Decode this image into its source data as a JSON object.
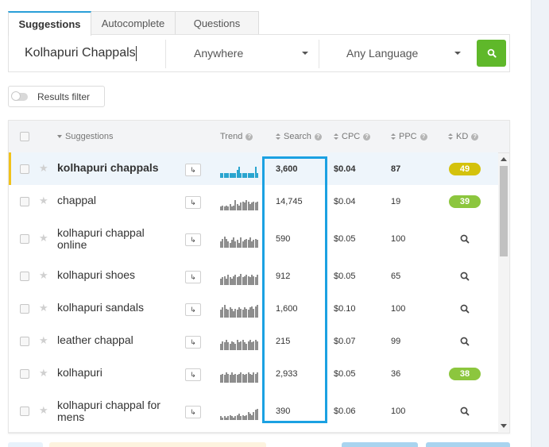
{
  "tabs": [
    {
      "label": "Suggestions",
      "active": true
    },
    {
      "label": "Autocomplete",
      "active": false
    },
    {
      "label": "Questions",
      "active": false
    }
  ],
  "search": {
    "keyword": "Kolhapuri Chappals",
    "location": "Anywhere",
    "language": "Any Language",
    "button_icon": "search-icon"
  },
  "filter": {
    "label": "Results filter",
    "enabled": false
  },
  "table": {
    "headers": {
      "suggestions": "Suggestions",
      "trend": "Trend",
      "search": "Search",
      "cpc": "CPC",
      "ppc": "PPC",
      "kd": "KD"
    },
    "rows": [
      {
        "keyword": "kolhapuri chappals",
        "search": "3,600",
        "cpc": "$0.04",
        "ppc": "87",
        "kd": "49",
        "kd_color": "#d4c20c",
        "trend": [
          0.35,
          0.35,
          0.35,
          0.35,
          0.35,
          0.35,
          0.35,
          0.35,
          0.35,
          0.6,
          0.9,
          0.35,
          0.35,
          0.35,
          0.4,
          0.35,
          0.35,
          0.35,
          0.4,
          0.9,
          0.35
        ],
        "highlighted": true
      },
      {
        "keyword": "chappal",
        "search": "14,745",
        "cpc": "$0.04",
        "ppc": "19",
        "kd": "39",
        "kd_color": "#8cc63e",
        "trend": [
          0.3,
          0.4,
          0.3,
          0.4,
          0.3,
          0.5,
          0.3,
          0.4,
          0.8,
          0.5,
          0.4,
          0.6,
          0.7,
          0.6,
          0.8,
          0.7,
          0.5,
          0.6,
          0.7,
          0.6,
          0.7
        ],
        "highlighted": false
      },
      {
        "keyword": "kolhapuri chappal online",
        "search": "590",
        "cpc": "$0.05",
        "ppc": "100",
        "kd": "",
        "trend": [
          0.5,
          0.7,
          0.9,
          0.7,
          0.5,
          0.4,
          0.6,
          0.8,
          0.5,
          0.6,
          0.4,
          0.8,
          0.5,
          0.6,
          0.7,
          0.6,
          0.8,
          0.5,
          0.6,
          0.7,
          0.6
        ],
        "highlighted": false
      },
      {
        "keyword": "kolhapuri shoes",
        "search": "912",
        "cpc": "$0.05",
        "ppc": "65",
        "kd": "",
        "trend": [
          0.5,
          0.6,
          0.7,
          0.5,
          0.8,
          0.6,
          0.5,
          0.7,
          0.8,
          0.6,
          0.7,
          0.9,
          0.6,
          0.7,
          0.8,
          0.7,
          0.6,
          0.8,
          0.7,
          0.6,
          0.8
        ],
        "highlighted": false
      },
      {
        "keyword": "kolhapuri sandals",
        "search": "1,600",
        "cpc": "$0.10",
        "ppc": "100",
        "kd": "",
        "trend": [
          0.6,
          0.8,
          1.0,
          0.7,
          0.6,
          0.8,
          0.7,
          0.5,
          0.7,
          0.6,
          0.8,
          0.7,
          0.6,
          0.8,
          0.7,
          0.6,
          0.8,
          0.9,
          0.7,
          0.9,
          1.0
        ],
        "highlighted": false
      },
      {
        "keyword": "leather chappal",
        "search": "215",
        "cpc": "$0.07",
        "ppc": "99",
        "kd": "",
        "trend": [
          0.5,
          0.7,
          0.6,
          0.8,
          0.6,
          0.5,
          0.7,
          0.6,
          0.5,
          0.8,
          0.6,
          0.7,
          0.8,
          0.6,
          0.5,
          0.7,
          0.8,
          0.6,
          0.7,
          0.8,
          0.7
        ],
        "highlighted": false
      },
      {
        "keyword": "kolhapuri",
        "search": "2,933",
        "cpc": "$0.05",
        "ppc": "36",
        "kd": "38",
        "kd_color": "#8cc63e",
        "trend": [
          0.6,
          0.7,
          0.6,
          0.8,
          0.7,
          0.6,
          0.8,
          0.6,
          0.7,
          0.6,
          0.7,
          0.8,
          0.7,
          0.6,
          0.7,
          0.8,
          0.7,
          0.6,
          0.8,
          0.7,
          0.8
        ],
        "highlighted": false
      },
      {
        "keyword": "kolhapuri chappal for mens",
        "search": "390",
        "cpc": "$0.06",
        "ppc": "100",
        "kd": "",
        "trend": [
          0.3,
          0.2,
          0.3,
          0.2,
          0.3,
          0.4,
          0.3,
          0.2,
          0.3,
          0.4,
          0.5,
          0.3,
          0.4,
          0.3,
          0.4,
          0.6,
          0.5,
          0.4,
          0.6,
          0.8,
          0.9
        ],
        "highlighted": false
      }
    ]
  },
  "colors": {
    "accent_tab": "#2a9fd8",
    "search_button": "#5fb82a",
    "highlight_box": "#1ba1e2",
    "trend_bar_highlighted": "#2aa5cf",
    "trend_bar": "#8e8e8e"
  }
}
